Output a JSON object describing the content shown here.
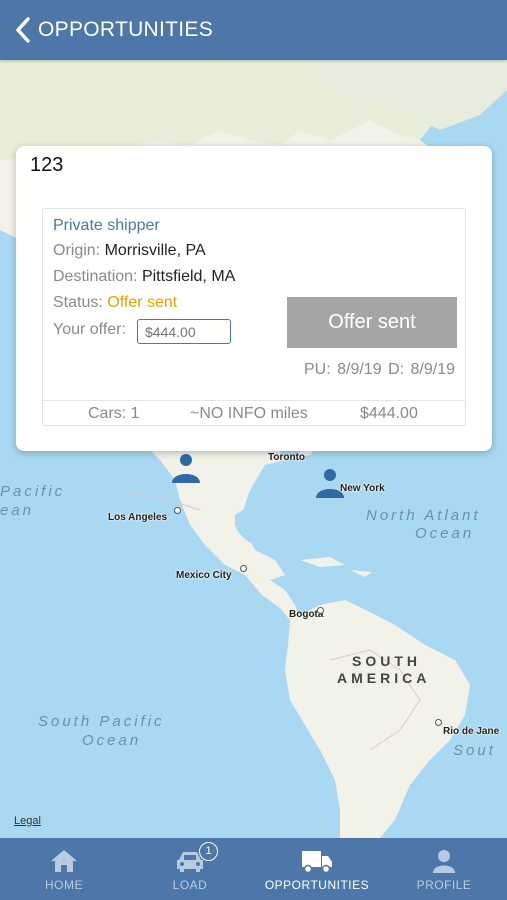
{
  "header": {
    "title": "OPPORTUNITIES"
  },
  "map": {
    "cities": [
      "Toronto",
      "New York",
      "Los Angeles",
      "Mexico City",
      "Bogotá",
      "Rio de Jane"
    ],
    "oceans": [
      "Pacific",
      "ean",
      "North Atlant",
      "Ocean",
      "South Pacific",
      "Ocean",
      "Sout"
    ],
    "continent": [
      "SOUTH",
      "AMERICA"
    ],
    "legal": "Legal"
  },
  "card": {
    "id": "123",
    "shipper": "Private shipper",
    "origin_label": "Origin:",
    "origin": "Morrisville, PA",
    "destination_label": "Destination:",
    "destination": "Pittsfield, MA",
    "status_label": "Status:",
    "status": "Offer sent",
    "offer_label": "Your offer:",
    "offer_placeholder": "$444.00",
    "button_label": "Offer sent",
    "pickup": "PU: 8/9/19",
    "delivery": "D: 8/9/19",
    "cars": "Cars: 1",
    "miles": "~NO INFO miles",
    "price": "$444.00"
  },
  "tabs": [
    {
      "label": "HOME",
      "icon": "home-icon"
    },
    {
      "label": "LOAD",
      "icon": "car-icon",
      "badge": "1"
    },
    {
      "label": "OPPORTUNITIES",
      "icon": "truck-icon"
    },
    {
      "label": "PROFILE",
      "icon": "person-icon"
    }
  ],
  "colors": {
    "primary": "#4d77a8",
    "status": "#e8a000",
    "button": "#a5a5a5",
    "water": "#a9d8f2",
    "land": "#f3f2e9"
  }
}
